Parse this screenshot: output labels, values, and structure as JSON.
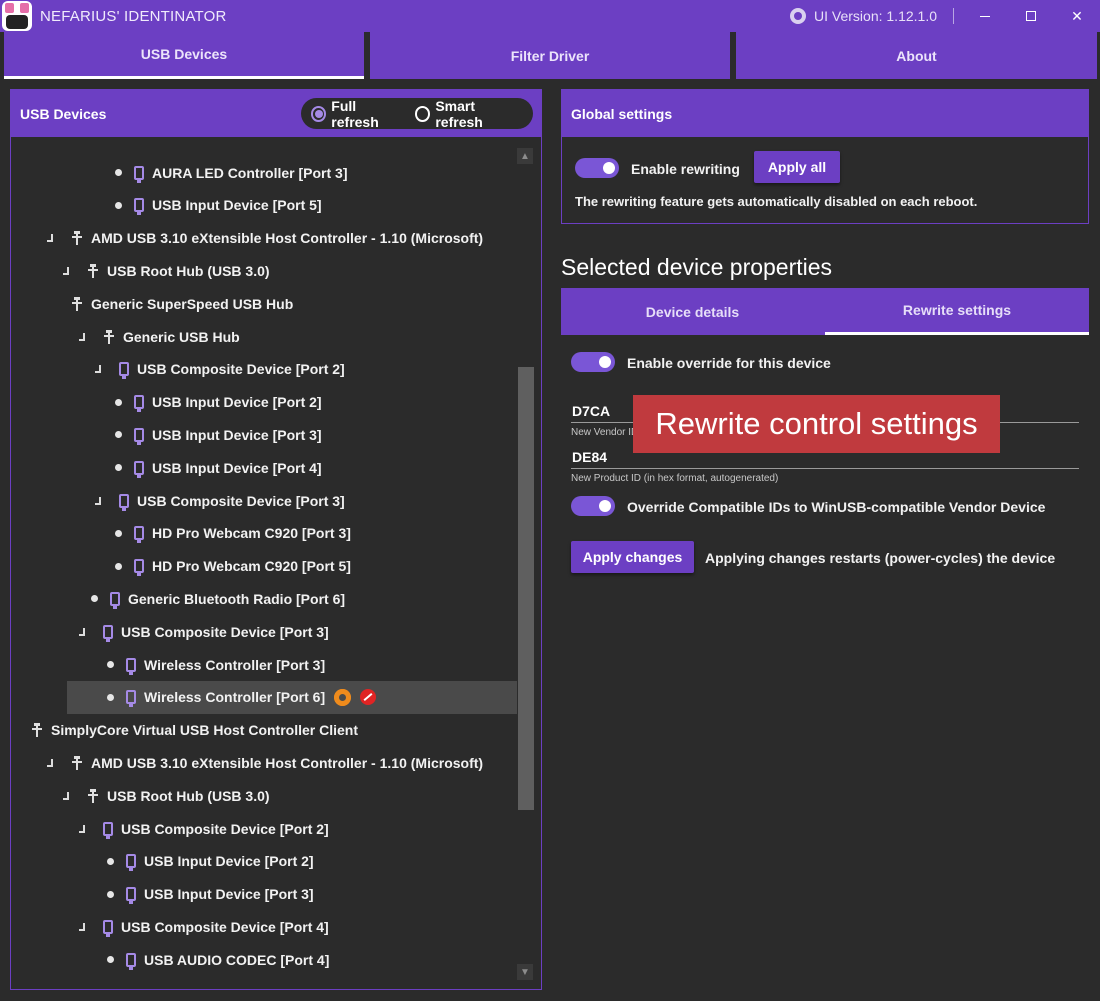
{
  "window": {
    "title": "NEFARIUS' IDENTINATOR",
    "version": "UI Version: 1.12.1.0",
    "close_glyph": "✕"
  },
  "top_tabs": [
    {
      "label": "USB Devices",
      "active": true
    },
    {
      "label": "Filter Driver",
      "active": false
    },
    {
      "label": "About",
      "active": false
    }
  ],
  "left": {
    "title": "USB Devices",
    "full_refresh": "Full refresh",
    "smart_refresh": "Smart refresh",
    "refresh_mode": "Full refresh",
    "tree": [
      {
        "label": "AURA LED Controller [Port 3]",
        "level": 5,
        "kind": "device"
      },
      {
        "label": "USB Input Device [Port 5]",
        "level": 5,
        "kind": "device"
      },
      {
        "label": "AMD USB 3.10 eXtensible Host Controller - 1.10 (Microsoft)",
        "level": 1,
        "kind": "usb",
        "expanded": true
      },
      {
        "label": "USB Root Hub (USB 3.0)",
        "level": 2,
        "kind": "usb",
        "expanded": true
      },
      {
        "label": "Generic SuperSpeed USB Hub",
        "level": 2.5,
        "kind": "usb-noexp"
      },
      {
        "label": "Generic USB Hub",
        "level": 3,
        "kind": "usb",
        "expanded": true
      },
      {
        "label": "USB Composite Device [Port 2]",
        "level": 4,
        "kind": "device",
        "expanded": true
      },
      {
        "label": "USB Input Device [Port 2]",
        "level": 5,
        "kind": "device"
      },
      {
        "label": "USB Input Device [Port 3]",
        "level": 5,
        "kind": "device"
      },
      {
        "label": "USB Input Device [Port 4]",
        "level": 5,
        "kind": "device"
      },
      {
        "label": "USB Composite Device [Port 3]",
        "level": 4,
        "kind": "device",
        "expanded": true
      },
      {
        "label": "HD Pro Webcam C920 [Port 3]",
        "level": 5,
        "kind": "device"
      },
      {
        "label": "HD Pro Webcam C920 [Port 5]",
        "level": 5,
        "kind": "device"
      },
      {
        "label": "Generic Bluetooth Radio [Port 6]",
        "level": 3.5,
        "kind": "device"
      },
      {
        "label": "USB Composite Device [Port 3]",
        "level": 3,
        "kind": "device",
        "expanded": true
      },
      {
        "label": "Wireless Controller [Port 3]",
        "level": 4.5,
        "kind": "device"
      },
      {
        "label": "Wireless Controller [Port 6]",
        "level": 4.5,
        "kind": "device",
        "selected": true
      },
      {
        "label": "SimplyCore Virtual USB Host Controller Client",
        "level": 0,
        "kind": "usb-noexp"
      },
      {
        "label": "AMD USB 3.10 eXtensible Host Controller - 1.10 (Microsoft)",
        "level": 1,
        "kind": "usb",
        "expanded": true
      },
      {
        "label": "USB Root Hub (USB 3.0)",
        "level": 2,
        "kind": "usb",
        "expanded": true
      },
      {
        "label": "USB Composite Device [Port 2]",
        "level": 3,
        "kind": "device",
        "expanded": true
      },
      {
        "label": "USB Input Device [Port 2]",
        "level": 4.5,
        "kind": "device"
      },
      {
        "label": "USB Input Device [Port 3]",
        "level": 4.5,
        "kind": "device"
      },
      {
        "label": "USB Composite Device [Port 4]",
        "level": 3,
        "kind": "device",
        "expanded": true
      },
      {
        "label": "USB AUDIO  CODEC [Port 4]",
        "level": 4.5,
        "kind": "device"
      }
    ]
  },
  "global": {
    "title": "Global settings",
    "enable_rewriting": "Enable rewriting",
    "apply_all": "Apply all",
    "note": "The rewriting feature gets automatically disabled on each reboot."
  },
  "props": {
    "title": "Selected device properties",
    "tabs": [
      {
        "label": "Device details",
        "active": false
      },
      {
        "label": "Rewrite settings",
        "active": true
      }
    ],
    "enable_override": "Enable override for this device",
    "vendor_id": "D7CA",
    "vendor_hint": "New Vendor ID (in hex format, autogenerated)",
    "product_id": "DE84",
    "product_hint": "New Product ID (in hex format, autogenerated)",
    "override_compat": "Override Compatible IDs to WinUSB-compatible Vendor Device",
    "apply_changes": "Apply changes",
    "apply_note": "Applying changes restarts (power-cycles) the device"
  },
  "overlay": {
    "text": "Rewrite control settings"
  },
  "colors": {
    "accent": "#6c3fc3",
    "background": "#2b2b2b",
    "selected_row": "#4a4a4a",
    "gear": "#ef8b1c",
    "block": "#e02424",
    "overlay": "#c03a3e"
  }
}
